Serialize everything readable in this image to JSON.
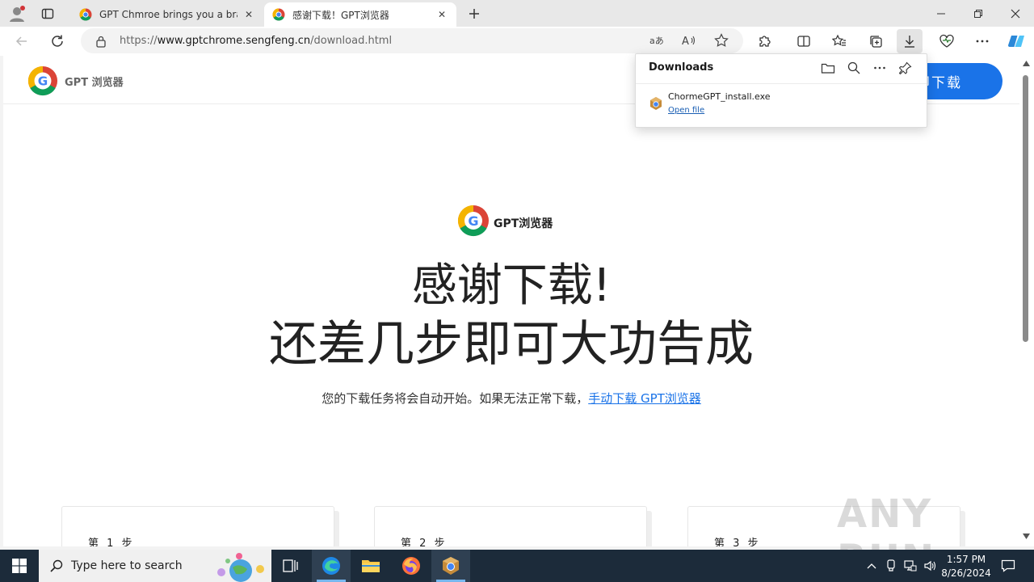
{
  "browser": {
    "tabs": [
      {
        "title": "GPT Chmroe brings you a brand new",
        "active": false
      },
      {
        "title": "感谢下载！GPT浏览器",
        "active": true
      }
    ],
    "url_prefix": "https://",
    "url_host": "www.gptchrome.sengfeng.cn",
    "url_path": "/download.html"
  },
  "site": {
    "header_brand": "GPT 浏览器",
    "header_cta": "即下载",
    "hero_brand": "GPT浏览器",
    "hero_line1": "感谢下载!",
    "hero_line2": "还差几步即可大功告成",
    "hero_sub_text": "您的下载任务将会自动开始。如果无法正常下载，",
    "hero_sub_link": "手动下载 GPT浏览器",
    "steps": [
      "第 1 步",
      "第 2 步",
      "第 3 步"
    ]
  },
  "downloads": {
    "title": "Downloads",
    "file_name": "ChormeGPT_install.exe",
    "open_label": "Open file"
  },
  "watermark": "ANY RUN",
  "taskbar": {
    "search_placeholder": "Type here to search",
    "time": "1:57 PM",
    "date": "8/26/2024"
  },
  "colors": {
    "accent": "#1a73e8",
    "taskbar": "#1c2b3a"
  }
}
